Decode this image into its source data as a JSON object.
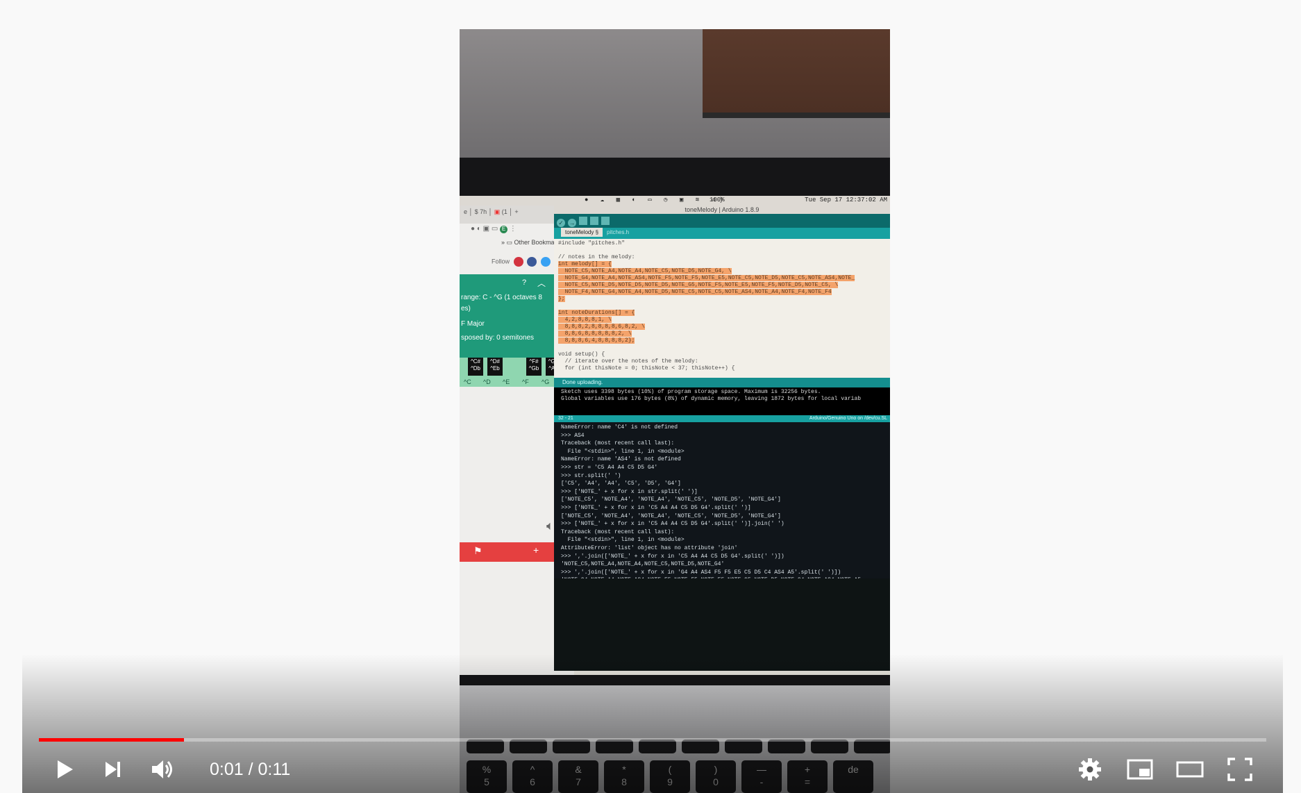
{
  "player": {
    "time_current": "0:01",
    "time_separator": " / ",
    "time_total": "0:11",
    "progress_fraction": 0.118,
    "accent_color": "#ff0000"
  },
  "video": {
    "menubar_clock": "Tue Sep 17  12:37:02 AM",
    "menubar_battery": "100%",
    "browser": {
      "bookmarks_label": "Other Bookmarks",
      "follow_label": "Follow",
      "range_label": "range: C - ^G   (1 octaves 8",
      "range_cont": "es)",
      "key_label": "F Major",
      "transposed_label": "sposed by: 0 semitones",
      "black_keys": [
        "^C#\n^Db",
        "^D#\n^Eb",
        "^F#\n^Gb",
        "^G#\n^Ab"
      ],
      "white_keys": [
        "^C",
        "^D",
        "^E",
        "^F",
        "^G"
      ]
    },
    "ide": {
      "window_title": "toneMelody | Arduino 1.8.9",
      "tab_active": "toneMelody §",
      "tab_other": "pitches.h",
      "code_include": "#include \"pitches.h\"",
      "code_comment": "// notes in the melody:",
      "code_melody_decl": "int melody[] = {",
      "code_melody_1": "  NOTE_C5,NOTE_A4,NOTE_A4,NOTE_C5,NOTE_D5,NOTE_G4, \\",
      "code_melody_2": "  NOTE_G4,NOTE_A4,NOTE_AS4,NOTE_F5,NOTE_F5,NOTE_E5,NOTE_C5,NOTE_D5,NOTE_C5,NOTE_AS4,NOTE_",
      "code_melody_3": "  NOTE_C5,NOTE_D5,NOTE_D5,NOTE_D5,NOTE_G5,NOTE_F5,NOTE_E5,NOTE_F5,NOTE_D5,NOTE_C5, \\",
      "code_melody_4": "  NOTE_F4,NOTE_G4,NOTE_A4,NOTE_D5,NOTE_C5,NOTE_C5,NOTE_AS4,NOTE_A4,NOTE_F4,NOTE_F4",
      "code_melody_end": "};",
      "code_dur_decl": "int noteDurations[] = {",
      "code_dur_1": "  4,2,8,8,8,1, \\",
      "code_dur_2": "  8,8,8,2,8,8,8,8,6,8,2, \\",
      "code_dur_3": "  8,8,6,8,8,8,8,8,2, \\",
      "code_dur_4": "  8,8,8,6,4,8,8,8,8,2};",
      "code_setup": "void setup() {",
      "code_setup_comment": "  // iterate over the notes of the melody:",
      "code_for": "  for (int thisNote = 0; thisNote < 37; thisNote++) {",
      "status": "Done uploading.",
      "console_1": "Sketch uses 3398 bytes (10%) of program storage space. Maximum is 32256 bytes.",
      "console_2": "Global variables use 176 bytes (8%) of dynamic memory, leaving 1872 bytes for local variab",
      "board_label": "Arduino/Genuino Uno on /dev/cu.SL",
      "line_label": "32 - 21"
    },
    "terminal_lines": [
      "NameError: name 'C4' is not defined",
      ">>> AS4",
      "Traceback (most recent call last):",
      "  File \"<stdin>\", line 1, in <module>",
      "NameError: name 'AS4' is not defined",
      ">>> str = 'C5 A4 A4 C5 D5 G4'",
      ">>> str.split(' ')",
      "['C5', 'A4', 'A4', 'C5', 'D5', 'G4']",
      ">>> ['NOTE_' + x for x in str.split(' ')]",
      "['NOTE_C5', 'NOTE_A4', 'NOTE_A4', 'NOTE_C5', 'NOTE_D5', 'NOTE_G4']",
      ">>> ['NOTE_' + x for x in 'C5 A4 A4 C5 D5 G4'.split(' ')]",
      "['NOTE_C5', 'NOTE_A4', 'NOTE_A4', 'NOTE_C5', 'NOTE_D5', 'NOTE_G4']",
      ">>> ['NOTE_' + x for x in 'C5 A4 A4 C5 D5 G4'.split(' ')].join(' ')",
      "Traceback (most recent call last):",
      "  File \"<stdin>\", line 1, in <module>",
      "AttributeError: 'list' object has no attribute 'join'",
      ">>> ','.join(['NOTE_' + x for x in 'C5 A4 A4 C5 D5 G4'.split(' ')])",
      "'NOTE_C5,NOTE_A4,NOTE_A4,NOTE_C5,NOTE_D5,NOTE_G4'",
      ">>> ','.join(['NOTE_' + x for x in 'G4 A4 AS4 F5 F5 E5 C5 D5 C4 AS4 A5'.split(' ')])",
      "'NOTE_G4,NOTE_A4,NOTE_AS4,NOTE_F5,NOTE_F5,NOTE_E5,NOTE_C5,NOTE_D5,NOTE_C4,NOTE_AS4,NOTE_A5",
      ">>> []"
    ],
    "keyboard_keys": [
      "%\n5",
      "^\n6",
      "&\n7",
      "*\n8",
      "(\n9",
      ")\n0",
      "—\n-",
      "+\n=",
      "de"
    ]
  },
  "icons": {
    "play": "play-icon",
    "next": "next-icon",
    "volume": "volume-icon",
    "settings": "gear-icon",
    "miniplayer": "miniplayer-icon",
    "theater": "theater-mode-icon",
    "fullscreen": "fullscreen-icon"
  }
}
